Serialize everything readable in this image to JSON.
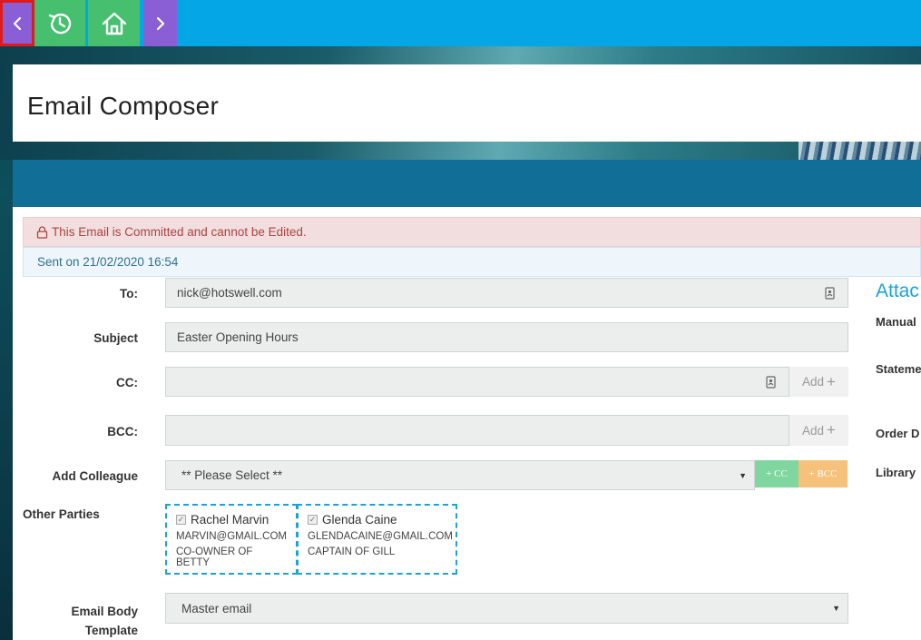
{
  "nav": {
    "back_icon": "chevron-left-icon",
    "history_icon": "history-icon",
    "home_icon": "home-icon",
    "forward_icon": "chevron-right-icon"
  },
  "page": {
    "title": "Email Composer"
  },
  "alerts": {
    "committed": "This Email is Committed and cannot be Edited.",
    "sent": "Sent on 21/02/2020 16:54"
  },
  "form": {
    "to_label": "To:",
    "to_value": "nick@hotswell.com",
    "subject_label": "Subject",
    "subject_value": "Easter Opening Hours",
    "cc_label": "CC:",
    "cc_value": "",
    "bcc_label": "BCC:",
    "bcc_value": "",
    "add_label": "Add",
    "add_colleague_label": "Add Colleague",
    "add_colleague_value": "** Please Select **",
    "cc_button": "+ CC",
    "bcc_button": "+ BCC",
    "other_parties_label": "Other Parties",
    "email_body_label_1": "Email Body",
    "email_body_label_2": "Template",
    "email_body_value": "Master email"
  },
  "parties": [
    {
      "name": "Rachel Marvin",
      "email": "MARVIN@GMAIL.COM",
      "role": "CO-OWNER OF BETTY"
    },
    {
      "name": "Glenda Caine",
      "email": "GLENDACAINE@GMAIL.COM",
      "role": "CAPTAIN OF GILL"
    }
  ],
  "attachments": {
    "title": "Attac",
    "items": [
      "Manual",
      "Stateme",
      "Order D",
      "Library"
    ]
  },
  "colors": {
    "topbar": "#05a6e6",
    "nav_purple": "#8a5fd6",
    "nav_green": "#46c06f",
    "bluebar": "#116e96",
    "accent": "#1aa3d8"
  }
}
